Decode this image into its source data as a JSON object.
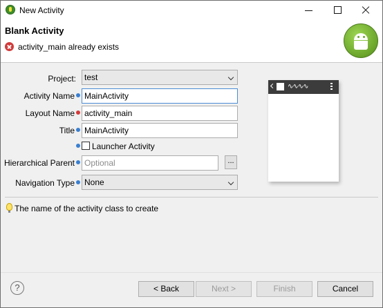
{
  "window": {
    "title": "New Activity"
  },
  "header": {
    "title": "Blank Activity",
    "error": "activity_main already exists"
  },
  "form": {
    "project": {
      "label": "Project:",
      "value": "test"
    },
    "activity_name": {
      "label": "Activity Name",
      "value": "MainActivity"
    },
    "layout_name": {
      "label": "Layout Name",
      "value": "activity_main"
    },
    "title": {
      "label": "Title",
      "value": "MainActivity"
    },
    "launcher": {
      "label": "Launcher Activity",
      "checked": false
    },
    "hierarchical_parent": {
      "label": "Hierarchical Parent",
      "placeholder": "Optional",
      "browse_label": "..."
    },
    "navigation_type": {
      "label": "Navigation Type",
      "value": "None"
    }
  },
  "preview": {
    "title_glyph": "∿∿∿∿"
  },
  "hint": "The name of the activity class to create",
  "buttons": {
    "help": "?",
    "back": "< Back",
    "next": "Next >",
    "finish": "Finish",
    "cancel": "Cancel"
  },
  "colors": {
    "info_dot": "#3a7fd0",
    "error_dot": "#d43a3a",
    "focus_border": "#4a8bd6"
  }
}
